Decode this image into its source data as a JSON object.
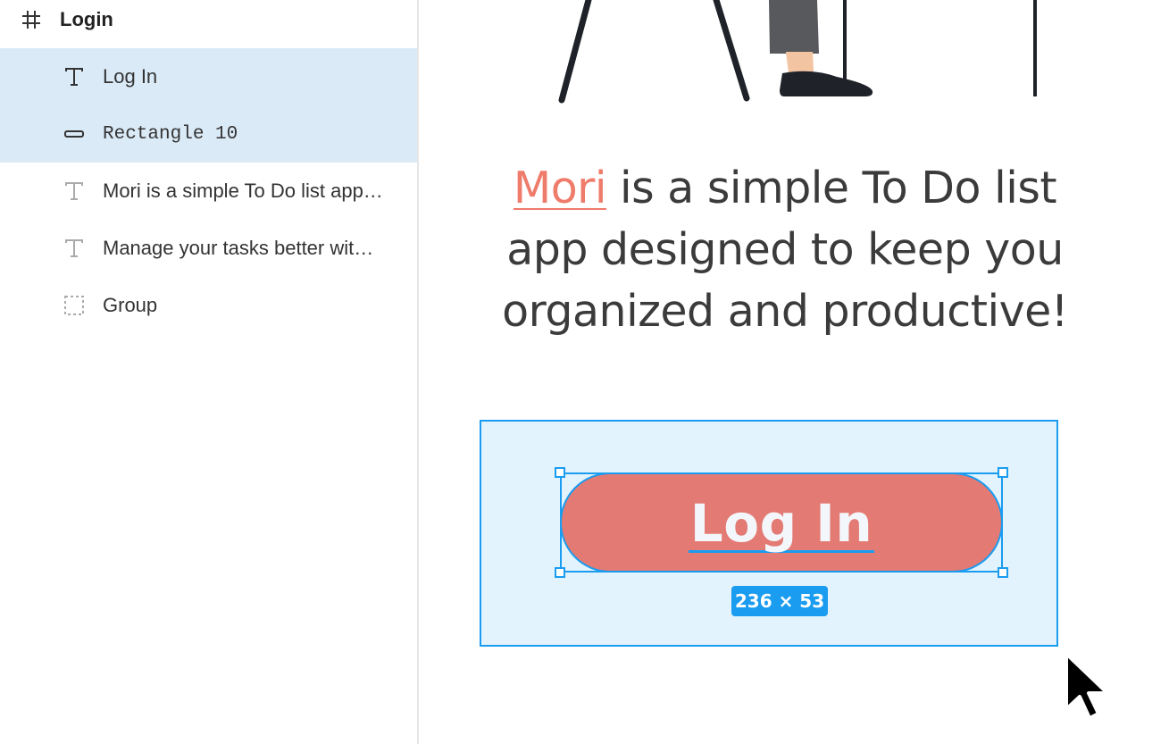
{
  "layers": {
    "frame": {
      "name": "Login",
      "icon": "hash-icon"
    },
    "items": [
      {
        "name": "Log In",
        "type": "text",
        "icon": "text-icon",
        "selected": true
      },
      {
        "name": "Rectangle 10",
        "type": "rectangle",
        "icon": "rectangle-icon",
        "selected": true
      },
      {
        "name": "Mori is a simple To Do list app…",
        "type": "text",
        "icon": "text-icon",
        "selected": false
      },
      {
        "name": "Manage your tasks better wit…",
        "type": "text",
        "icon": "text-icon",
        "selected": false
      },
      {
        "name": "Group",
        "type": "group",
        "icon": "group-icon",
        "selected": false
      }
    ]
  },
  "canvas": {
    "description": {
      "brand": "Mori",
      "rest": " is a simple To Do list app designed to keep you organized and productive!"
    },
    "button": {
      "label": "Log In"
    },
    "selection_size": "236 × 53"
  },
  "colors": {
    "selection_blue": "#1a9cf0",
    "row_selected_bg": "#dbeaf7",
    "brand_coral": "#ef7b6a",
    "button_fill": "#e37a73",
    "group_fill": "#e3f3fd"
  }
}
